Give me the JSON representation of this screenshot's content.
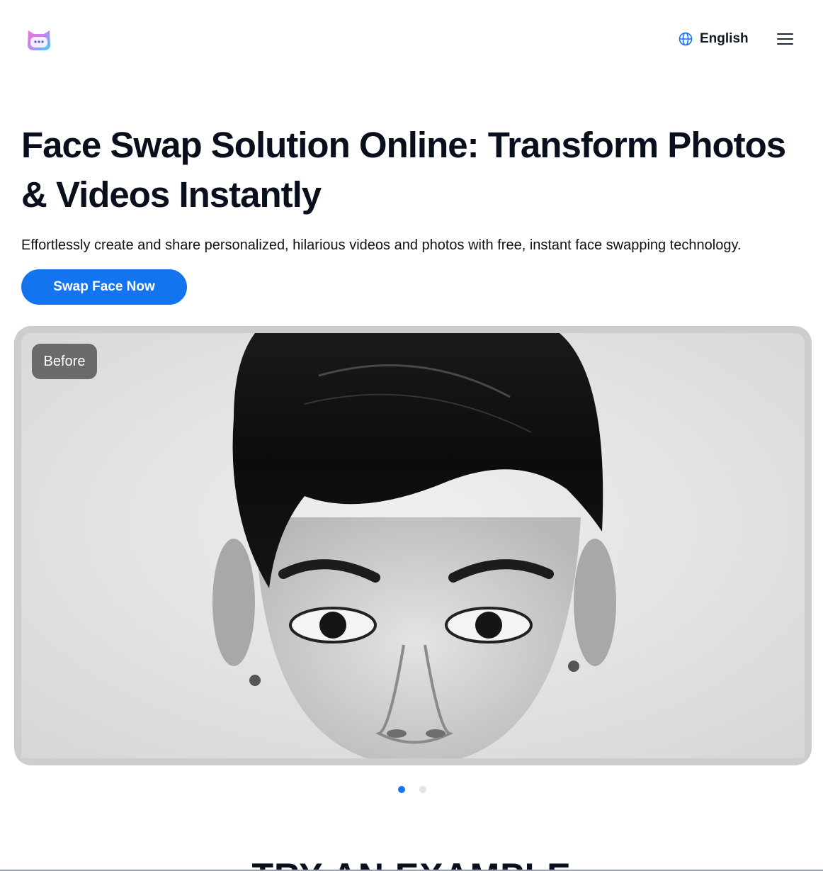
{
  "header": {
    "language_label": "English",
    "logo_icon": "cat-face-icon",
    "language_icon": "globe-icon",
    "menu_icon": "hamburger-menu-icon"
  },
  "hero": {
    "title": "Face Swap Solution Online: Transform Photos & Videos Instantly",
    "subtitle": "Effortlessly create and share personalized, hilarious videos and photos with free, instant face swapping technology.",
    "cta_label": "Swap Face Now"
  },
  "showcase": {
    "badge_label": "Before",
    "slide_count": 2,
    "active_slide": 1
  },
  "section": {
    "title": "TRY AN EXAMPLE"
  },
  "colors": {
    "accent": "#1374f0",
    "text": "#0a0f1e",
    "dot_inactive": "#e0e3ea",
    "frame": "#cdcdcd"
  }
}
